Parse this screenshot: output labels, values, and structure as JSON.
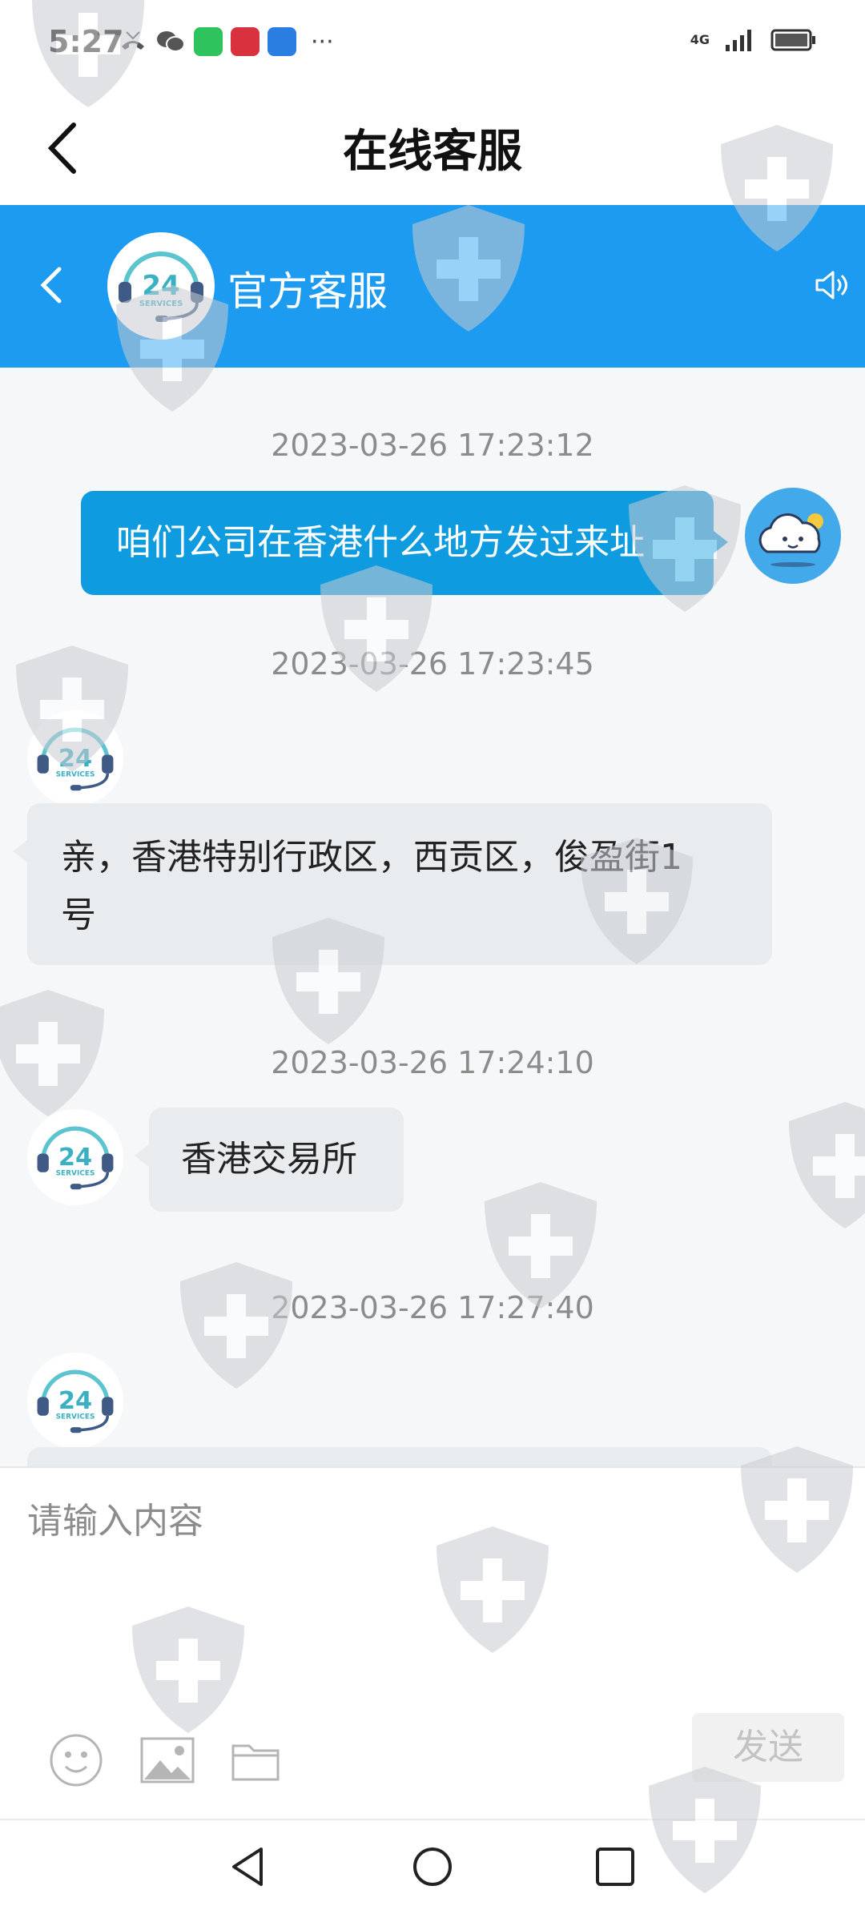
{
  "status_bar": {
    "time": "5:27",
    "network": "4G",
    "more": "···"
  },
  "header": {
    "title": "在线客服"
  },
  "service_header": {
    "name": "官方客服"
  },
  "chat": {
    "messages": [
      {
        "timestamp": "2023-03-26 17:23:12",
        "sender": "user",
        "text": "咱们公司在香港什么地方发过来址"
      },
      {
        "timestamp": "2023-03-26 17:23:45",
        "sender": "agent",
        "text_line1": "亲，香港特别行政区，西贡区，俊盈街1",
        "text_line2": "号"
      },
      {
        "timestamp": "2023-03-26 17:24:10",
        "sender": "agent",
        "text": "香港交易所"
      },
      {
        "timestamp": "2023-03-26 17:27:40",
        "sender": "agent",
        "text": ""
      }
    ]
  },
  "input": {
    "placeholder": "请输入内容",
    "send_label": "发送"
  },
  "icons": {
    "back": "back-arrow-icon",
    "speaker": "speaker-icon",
    "emoji": "emoji-icon",
    "image": "image-icon",
    "folder": "folder-icon",
    "nav_back": "nav-back-icon",
    "nav_home": "nav-home-icon",
    "nav_recent": "nav-recent-icon"
  },
  "colors": {
    "header_blue": "#1d9bf0",
    "bubble_blue": "#0f9be0"
  },
  "agent_avatar_badge": {
    "number": "24",
    "word": "SERVICES"
  }
}
